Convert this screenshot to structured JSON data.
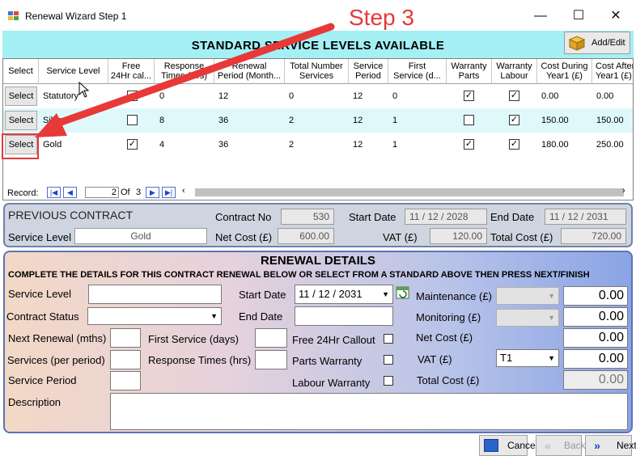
{
  "window": {
    "title": "Renewal Wizard Step 1",
    "controls": {
      "minimize": "—",
      "maximize": "☐",
      "close": "✕"
    }
  },
  "annotation": {
    "step_label": "Step 3"
  },
  "header": {
    "title": "STANDARD SERVICE LEVELS AVAILABLE",
    "add_edit_label": "Add/Edit"
  },
  "grid": {
    "columns": [
      {
        "line1": "Select",
        "line2": ""
      },
      {
        "line1": "Service Level",
        "line2": ""
      },
      {
        "line1": "Free",
        "line2": "24Hr cal..."
      },
      {
        "line1": "Response",
        "line2": "Times (Hrs)"
      },
      {
        "line1": "Renewal",
        "line2": "Period (Month..."
      },
      {
        "line1": "Total Number",
        "line2": "Services"
      },
      {
        "line1": "Service",
        "line2": "Period"
      },
      {
        "line1": "First",
        "line2": "Service (d..."
      },
      {
        "line1": "Warranty",
        "line2": "Parts"
      },
      {
        "line1": "Warranty",
        "line2": "Labour"
      },
      {
        "line1": "Cost During",
        "line2": "Year1 (£)"
      },
      {
        "line1": "Cost After",
        "line2": "Year1 (£)"
      }
    ],
    "select_label": "Select",
    "rows": [
      {
        "service_level": "Statutory",
        "free_24hr": false,
        "response": "0",
        "renewal": "12",
        "total_services": "0",
        "service_period": "12",
        "first_service": "0",
        "warranty_parts": true,
        "warranty_labour": true,
        "cost_year1": "0.00",
        "cost_after": "0.00"
      },
      {
        "service_level": "Silver",
        "free_24hr": false,
        "response": "8",
        "renewal": "36",
        "total_services": "2",
        "service_period": "12",
        "first_service": "1",
        "warranty_parts": false,
        "warranty_labour": true,
        "cost_year1": "150.00",
        "cost_after": "150.00"
      },
      {
        "service_level": "Gold",
        "free_24hr": true,
        "response": "4",
        "renewal": "36",
        "total_services": "2",
        "service_period": "12",
        "first_service": "1",
        "warranty_parts": true,
        "warranty_labour": true,
        "cost_year1": "180.00",
        "cost_after": "250.00"
      }
    ],
    "pager": {
      "record_label": "Record:",
      "current": "2",
      "of_label": "Of",
      "total": "3"
    }
  },
  "previous_contract": {
    "title": "PREVIOUS CONTRACT",
    "contract_no_label": "Contract No",
    "contract_no": "530",
    "start_date_label": "Start Date",
    "start_date": "11 / 12 / 2028",
    "end_date_label": "End Date",
    "end_date": "11 / 12 / 2031",
    "service_level_label": "Service Level",
    "service_level": "Gold",
    "net_cost_label": "Net Cost (£)",
    "net_cost": "600.00",
    "vat_label": "VAT (£)",
    "vat": "120.00",
    "total_cost_label": "Total Cost (£)",
    "total_cost": "720.00"
  },
  "renewal": {
    "title": "RENEWAL DETAILS",
    "subtitle": "COMPLETE THE DETAILS FOR THIS CONTRACT RENEWAL BELOW OR SELECT FROM A STANDARD  ABOVE THEN PRESS NEXT/FINISH",
    "service_level_label": "Service Level",
    "service_level_value": "",
    "contract_status_label": "Contract Status",
    "contract_status_value": "",
    "next_renewal_label": "Next Renewal (mths)",
    "services_label": "Services (per period)",
    "service_period_label": "Service Period",
    "description_label": "Description",
    "description_value": "",
    "first_service_label": "First Service (days)",
    "response_times_label": "Response Times (hrs)",
    "start_date_label": "Start Date",
    "start_date": "11 / 12 / 2031",
    "end_date_label": "End Date",
    "end_date": "",
    "free_callout_label": "Free 24Hr Callout",
    "parts_warranty_label": "Parts Warranty",
    "labour_warranty_label": "Labour Warranty",
    "maintenance_label": "Maintenance (£)",
    "maintenance_value": "0.00",
    "monitoring_label": "Monitoring (£)",
    "monitoring_value": "0.00",
    "net_cost_label": "Net Cost (£)",
    "net_cost_value": "0.00",
    "vat_label": "VAT (£)",
    "vat_code": "T1",
    "vat_value": "0.00",
    "total_cost_label": "Total Cost (£)",
    "total_cost_value": "0.00"
  },
  "footer": {
    "cancel": "Cancel",
    "back": "Back",
    "next": "Next"
  }
}
